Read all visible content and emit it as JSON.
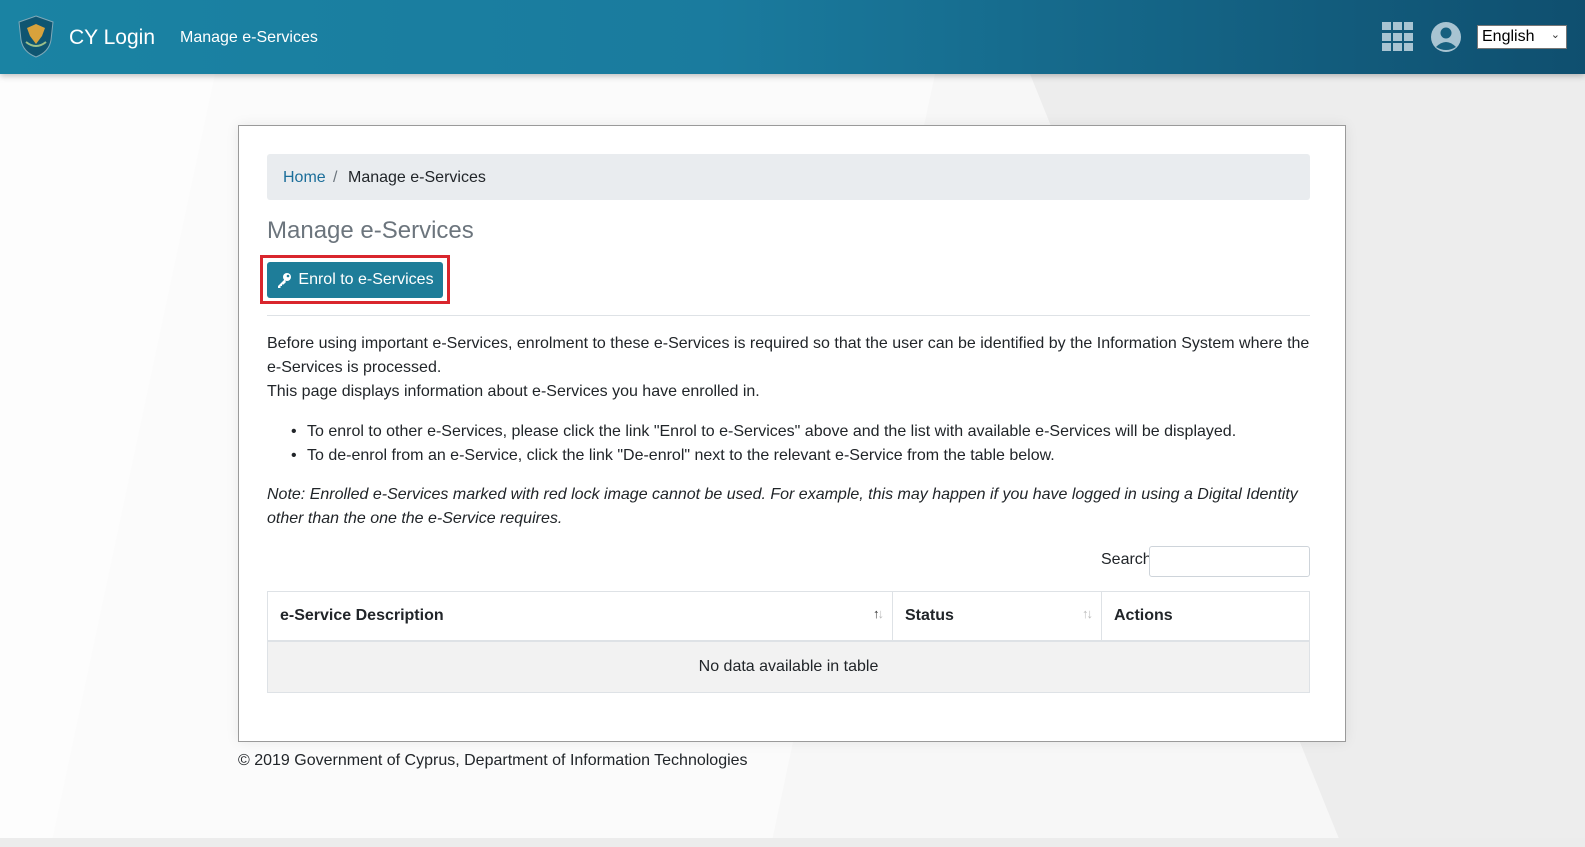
{
  "header": {
    "brand": "CY Login",
    "nav_link": "Manage e-Services",
    "language": "English"
  },
  "breadcrumb": {
    "home": "Home",
    "separator": "/",
    "current": "Manage e-Services"
  },
  "page": {
    "title": "Manage e-Services",
    "enrol_button": "Enrol to e-Services",
    "intro_line1": "Before using important e-Services, enrolment to these e-Services is required so that the user can be identified by the Information System where the e-Services is processed.",
    "intro_line2": "This page displays information about e-Services you have enrolled in.",
    "bullets": [
      "To enrol to other e-Services, please click the link \"Enrol to e-Services\" above and the list with available e-Services will be displayed.",
      "To de-enrol from an e-Service, click the link \"De-enrol\" next to the relevant e-Service from the table below."
    ],
    "note": "Note: Enrolled e-Services marked with red lock image cannot be used. For example, this may happen if you have logged in using a Digital Identity other than the one the e-Service requires."
  },
  "search": {
    "label": "Search:",
    "value": ""
  },
  "table": {
    "columns": [
      "e-Service Description",
      "Status",
      "Actions"
    ],
    "empty_message": "No data available in table"
  },
  "footer": {
    "text": "© 2019 Government of Cyprus, Department of Information Technologies"
  },
  "colors": {
    "header_start": "#1a83a3",
    "header_end": "#0f4f6f",
    "button": "#1e7d99",
    "highlight": "#d9262d",
    "link": "#1b6e9a"
  },
  "icons": [
    "cyprus-emblem-icon",
    "apps-grid-icon",
    "user-avatar-icon",
    "chevron-down-icon",
    "key-icon",
    "sort-icon"
  ]
}
